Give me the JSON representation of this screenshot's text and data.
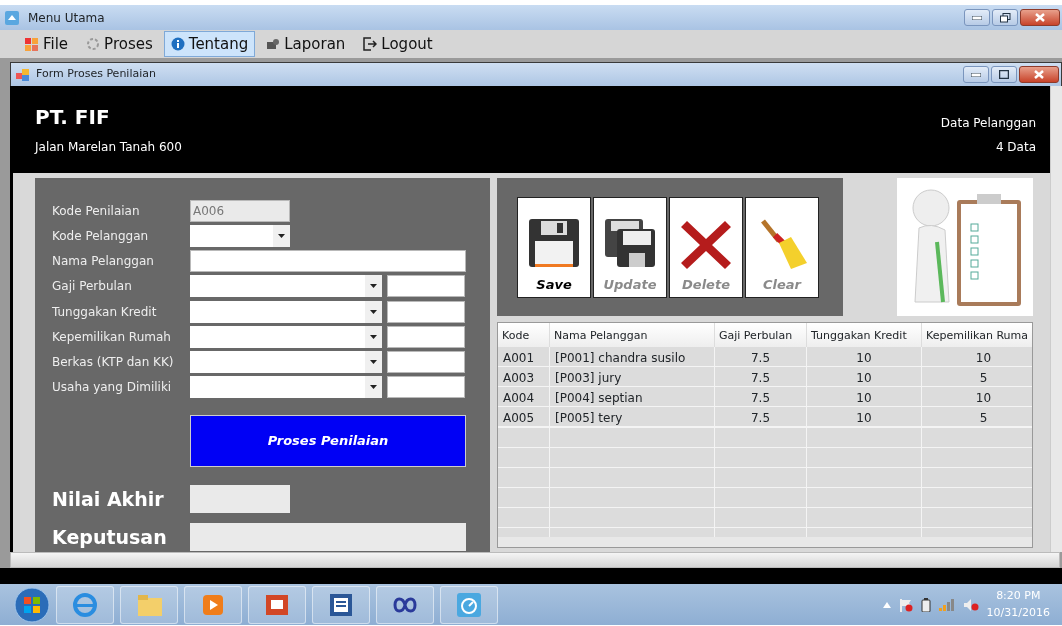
{
  "window": {
    "title": "Menu Utama"
  },
  "menu": [
    {
      "label": "File",
      "selected": false
    },
    {
      "label": "Proses",
      "selected": false
    },
    {
      "label": "Tentang",
      "selected": true
    },
    {
      "label": "Laporan",
      "selected": false
    },
    {
      "label": "Logout",
      "selected": false
    }
  ],
  "child_window": {
    "title": "Form Proses Penilaian"
  },
  "header": {
    "company": "PT. FIF",
    "address": "Jalan Marelan Tanah 600",
    "data_title": "Data Pelanggan",
    "data_count": "4 Data"
  },
  "form": {
    "fields": [
      {
        "label": "Kode Penilaian",
        "kind": "readonly",
        "value": "A006"
      },
      {
        "label": "Kode Pelanggan",
        "kind": "combo_short"
      },
      {
        "label": "Nama Pelanggan",
        "kind": "text"
      },
      {
        "label": "Gaji Perbulan",
        "kind": "combo_score"
      },
      {
        "label": "Tunggakan Kredit",
        "kind": "combo_score"
      },
      {
        "label": "Kepemilikan Rumah",
        "kind": "combo_score"
      },
      {
        "label": "Berkas (KTP dan KK)",
        "kind": "combo_score"
      },
      {
        "label": "Usaha yang Dimiliki",
        "kind": "combo_score"
      }
    ],
    "process_button": "Proses Penilaian",
    "results": [
      {
        "label": "Nilai Akhir",
        "kind": "short"
      },
      {
        "label": "Keputusan",
        "kind": "long"
      }
    ]
  },
  "actions": [
    {
      "label": "Save",
      "disabled": false
    },
    {
      "label": "Update",
      "disabled": true
    },
    {
      "label": "Delete",
      "disabled": true
    },
    {
      "label": "Clear",
      "disabled": true
    }
  ],
  "table": {
    "columns": [
      "Kode",
      "Nama Pelanggan",
      "Gaji Perbulan",
      "Tunggakan Kredit",
      "Kepemilikan Ruma"
    ],
    "rows": [
      [
        "A001",
        "[P001] chandra susilo",
        "7.5",
        "10",
        "10"
      ],
      [
        "A003",
        "[P003] jury",
        "7.5",
        "10",
        "5"
      ],
      [
        "A004",
        "[P004] septian",
        "7.5",
        "10",
        "10"
      ],
      [
        "A005",
        "[P005] tery",
        "7.5",
        "10",
        "5"
      ]
    ]
  },
  "taskbar": {
    "time": "8:20 PM",
    "date": "10/31/2016"
  }
}
